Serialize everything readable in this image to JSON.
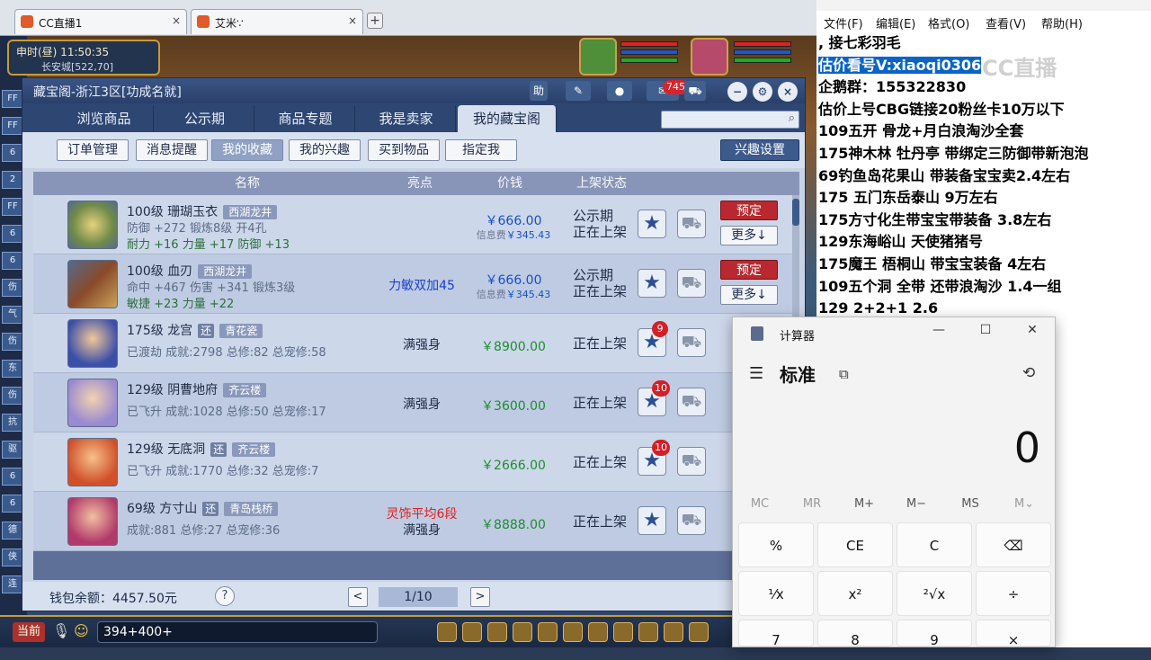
{
  "browser": {
    "tabs": [
      {
        "label": "CC直播1",
        "close": "×"
      },
      {
        "label": "艾米∵",
        "close": "×"
      }
    ],
    "add_tab": "+"
  },
  "game": {
    "clock": "申时(昼)  11:50:35",
    "location": "长安城[522,70]",
    "left_icons": [
      "FF",
      "FF",
      "6",
      "2",
      "FF",
      "6",
      "6",
      "伤",
      "气",
      "伤",
      "东",
      "伤",
      "抗",
      "驱",
      "6",
      "6",
      "德",
      "侠",
      "连"
    ]
  },
  "window": {
    "title": "藏宝阁-浙江3区[功成名就]",
    "title_help": "助",
    "notification_count": "745",
    "nav_tabs": [
      "浏览商品",
      "公示期",
      "商品专题",
      "我是卖家",
      "我的藏宝阁"
    ],
    "sub_buttons": [
      "订单管理",
      "消息提醒",
      "我的收藏",
      "我的兴趣",
      "买到物品",
      "指定我"
    ],
    "interest_settings": "兴趣设置",
    "columns": {
      "name": "名称",
      "highlight": "亮点",
      "price": "价钱",
      "status": "上架状态"
    },
    "fee_label": "信息费",
    "book_label": "预定",
    "more_label": "更多↓",
    "rows": [
      {
        "level": "100级",
        "name": "珊瑚玉衣",
        "server": "西湖龙井",
        "badge": "",
        "line2": "防御 +272 锻炼8级 开4孔",
        "line3": "耐力 +16 力量 +17 防御 +13",
        "highlight": "",
        "highlight2": "",
        "price": "￥666.00",
        "fee": "￥345.43",
        "status1": "公示期",
        "status2": "正在上架",
        "fav_count": ""
      },
      {
        "level": "100级",
        "name": "血刃",
        "server": "西湖龙井",
        "badge": "",
        "line2": "命中 +467 伤害 +341 锻炼3级",
        "line3": "敏捷 +23 力量 +22",
        "highlight": "力敏双加45",
        "highlight2": "",
        "price": "￥666.00",
        "fee": "￥345.43",
        "status1": "公示期",
        "status2": "正在上架",
        "fav_count": ""
      },
      {
        "level": "175级",
        "name": "龙宫",
        "server": "青花瓷",
        "badge": "还",
        "line2": "已渡劫 成就:2798 总修:82 总宠修:58",
        "line3": "",
        "highlight": "满强身",
        "highlight2": "",
        "price": "￥8900.00",
        "fee": "",
        "status1": "",
        "status2": "正在上架",
        "fav_count": "9"
      },
      {
        "level": "129级",
        "name": "阴曹地府",
        "server": "齐云楼",
        "badge": "还",
        "line2": "已飞升 成就:1028 总修:50 总宠修:17",
        "line3": "",
        "highlight": "满强身",
        "highlight2": "",
        "price": "￥3600.00",
        "fee": "",
        "status1": "",
        "status2": "正在上架",
        "fav_count": "10"
      },
      {
        "level": "129级",
        "name": "无底洞",
        "server": "齐云楼",
        "badge": "还",
        "line2": "已飞升 成就:1770 总修:32 总宠修:7",
        "line3": "",
        "highlight": "",
        "highlight2": "",
        "price": "￥2666.00",
        "fee": "",
        "status1": "",
        "status2": "正在上架",
        "fav_count": "10"
      },
      {
        "level": "69级",
        "name": "方寸山",
        "server": "青岛栈桥",
        "badge": "还",
        "line2": "成就:881 总修:27 总宠修:36",
        "line3": "",
        "highlight": "灵饰平均6段",
        "highlight2": "满强身",
        "price": "￥8888.00",
        "fee": "",
        "status1": "",
        "status2": "正在上架",
        "fav_count": ""
      }
    ],
    "wallet": "钱包余额：4457.50元",
    "help": "?",
    "page": "1/10",
    "prev": "<",
    "next": ">"
  },
  "chat": {
    "current": "当前",
    "input_value": "394+400+"
  },
  "notepad": {
    "menu": [
      "文件(F)",
      "编辑(E)",
      "格式(O)",
      "查看(V)",
      "帮助(H)"
    ],
    "lines": [
      ",      接七彩羽毛",
      "估价看号V:xiaoqi0306",
      "企鹅群：155322830",
      "估价上号CBG链接20粉丝卡10万以下",
      "109五开 骨龙+月白浪淘沙全套",
      "175神木林 牡丹亭  带绑定三防御带新泡泡",
      "69钓鱼岛花果山 带装备宝宝卖2.4左右",
      "175 五门东岳泰山  9万左右",
      "175方寸化生带宝宝带装备  3.8左右",
      "129东海峪山 天使猪猪号",
      "175魔王 梧桐山  带宝宝装备 4左右",
      "109五个洞 全带 还带浪淘沙  1.4一组",
      "129 2+2+1  2.6"
    ],
    "watermark": "CC直播"
  },
  "calculator": {
    "title": "计算器",
    "mode": "标准",
    "display": "0",
    "memory": [
      "MC",
      "MR",
      "M+",
      "M−",
      "MS",
      "M⌄"
    ],
    "keys_row1": [
      "%",
      "CE",
      "C",
      "⌫"
    ],
    "keys_row2": [
      "¹⁄x",
      "x²",
      "²√x",
      "÷"
    ],
    "keys_row3": [
      "7",
      "8",
      "9",
      "×"
    ]
  },
  "colors": {
    "accent": "#2e4672",
    "book": "#b8282e",
    "price_blue": "#1450c8",
    "price_green": "#1b8e2e",
    "highlight_red": "#e02020",
    "highlight_blue": "#1a3fd0"
  }
}
